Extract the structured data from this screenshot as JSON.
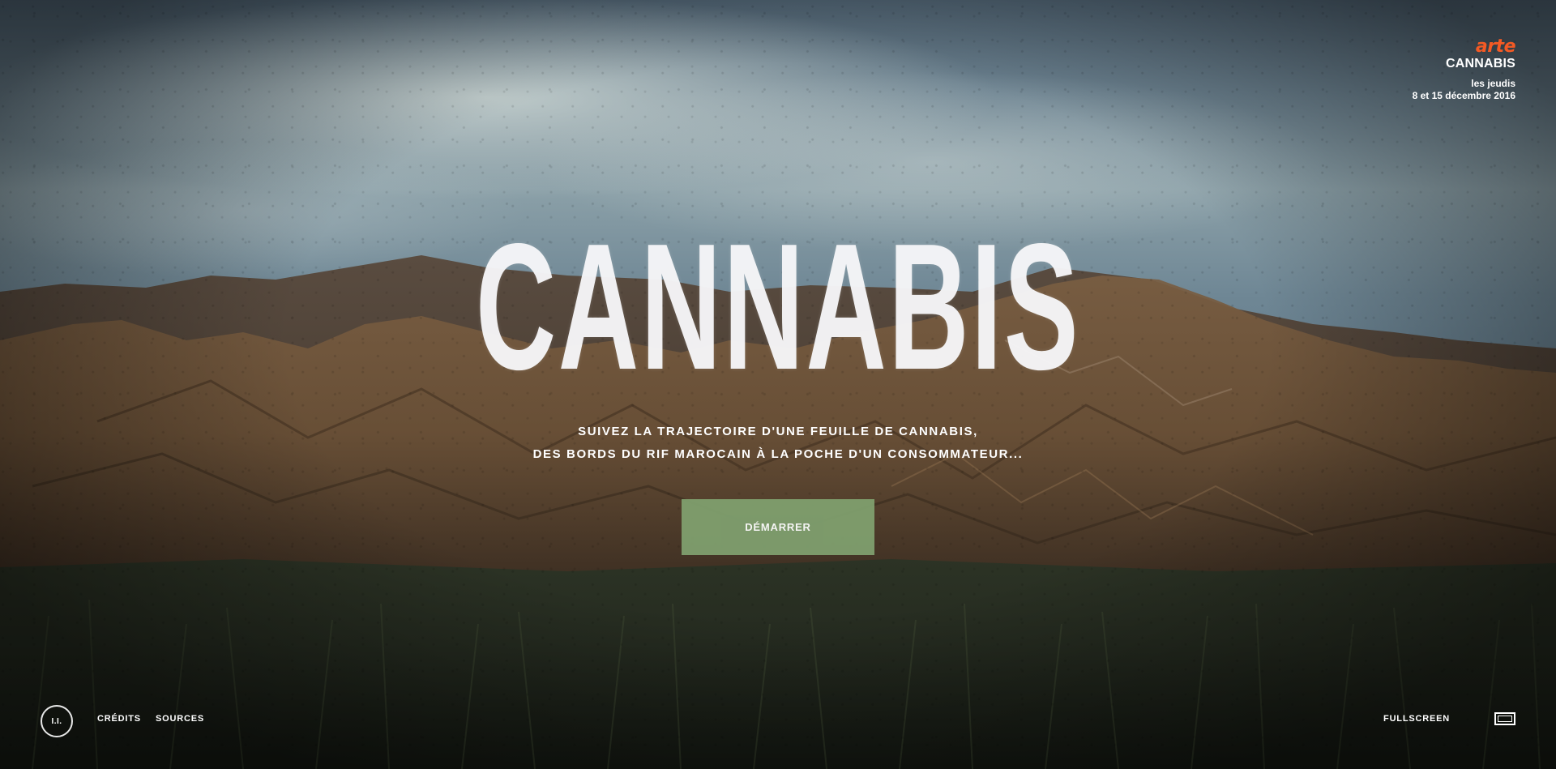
{
  "brand": {
    "logo_text": "arte",
    "title": "CANNABIS",
    "date_line1": "les jeudis",
    "date_line2": "8 et 15 décembre 2016"
  },
  "hero": {
    "title": "CANNABIS",
    "subtitle_line1": "SUIVEZ LA TRAJECTOIRE D'UNE FEUILLE DE CANNABIS,",
    "subtitle_line2": "DES BORDS DU RIF MAROCAIN À LA POCHE D'UN CONSOMMATEUR...",
    "start_label": "DÉMARRER"
  },
  "footer": {
    "about_label": "I.I.",
    "credits_label": "CRÉDITS",
    "sources_label": "SOURCES",
    "fullscreen_label": "FULLSCREEN"
  },
  "colors": {
    "brand_accent": "#f45a24",
    "start_button": "#7f9f6e",
    "text": "#ffffff"
  },
  "icons": {
    "about": "info-circle-icon",
    "fullscreen": "fullscreen-icon"
  }
}
